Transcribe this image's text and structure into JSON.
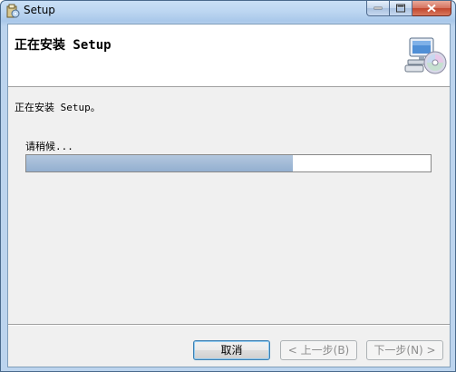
{
  "window": {
    "title": "Setup",
    "icons": {
      "app": "installer-icon",
      "minimize": "minimize-icon",
      "maximize": "maximize-icon",
      "close": "close-icon"
    }
  },
  "header": {
    "title": "正在安装 Setup",
    "icon": "computer-cd-icon"
  },
  "main": {
    "status": "正在安装 Setup。",
    "wait_label": "请稍候...",
    "progress_fraction": 0.66
  },
  "buttons": {
    "cancel": "取消",
    "back": "< 上一步(B)",
    "next": "下一步(N) >"
  },
  "colors": {
    "progress_fill": "#9db6d6",
    "close_button": "#c7503a"
  }
}
